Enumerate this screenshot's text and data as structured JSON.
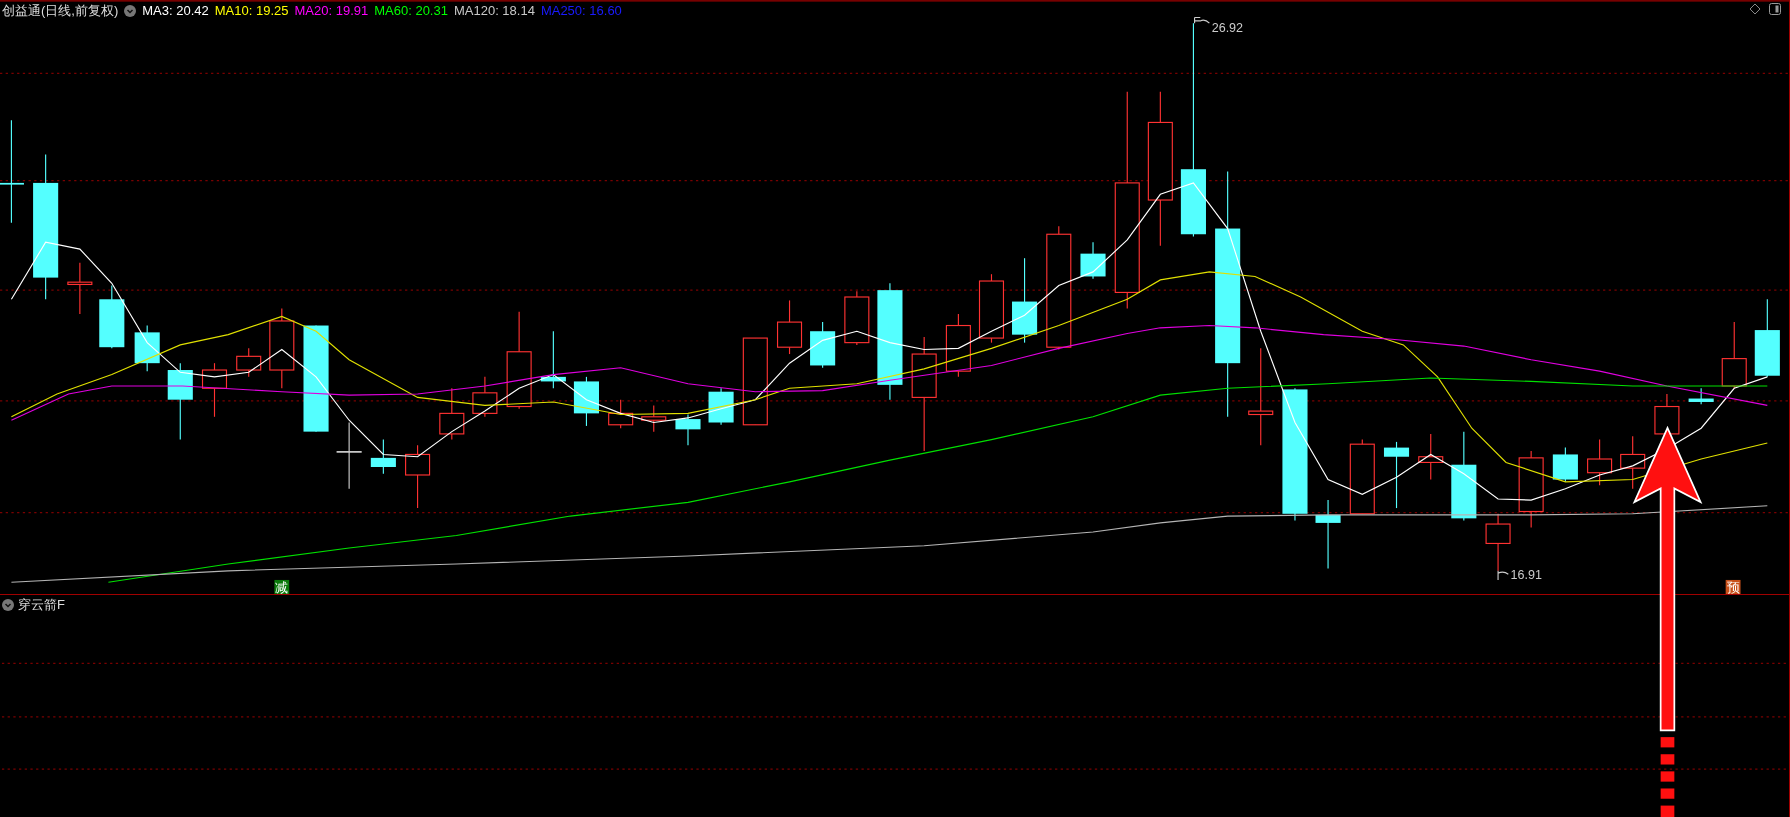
{
  "main_chart": {
    "title": "创益通(日线,前复权)",
    "indicators": [
      {
        "label": "MA3: 20.42",
        "color": "#ffffff"
      },
      {
        "label": "MA10: 19.25",
        "color": "#ffff00"
      },
      {
        "label": "MA20: 19.91",
        "color": "#ff00ff"
      },
      {
        "label": "MA60: 20.31",
        "color": "#00ff00"
      },
      {
        "label": "MA120: 18.14",
        "color": "#c8c8c8"
      },
      {
        "label": "MA250: 16.60",
        "color": "#1a1aff"
      }
    ],
    "high_label": "26.92",
    "low_label": "16.91",
    "signals": [
      {
        "text": "减",
        "color": "#0a7a0a"
      },
      {
        "text": "预",
        "color": "#c8501a"
      }
    ]
  },
  "sub_chart": {
    "title": "穿云箭F"
  }
}
